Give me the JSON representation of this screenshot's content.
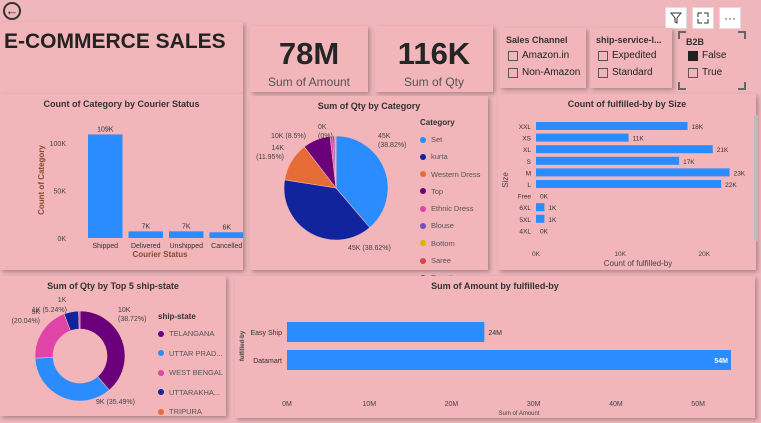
{
  "header": {
    "title": "E-COMMERCE SALES"
  },
  "kpis": {
    "amount": {
      "value": "78M",
      "label": "Sum of Amount"
    },
    "qty": {
      "value": "116K",
      "label": "Sum of Qty"
    }
  },
  "slicers": {
    "sales_channel": {
      "title": "Sales Channel",
      "options": [
        "Amazon.in",
        "Non-Amazon"
      ]
    },
    "ship_service": {
      "title": "ship-service-l...",
      "options": [
        "Expedited",
        "Standard"
      ]
    },
    "b2b": {
      "title": "B2B",
      "options": [
        "False",
        "True"
      ],
      "selected": "False"
    }
  },
  "toolbar": {
    "icons": [
      "filter-icon",
      "focus-mode-icon",
      "more-options-icon"
    ],
    "more_label": "···"
  },
  "colors": {
    "bar": "#2b8cff",
    "background": "#efb7bb"
  },
  "chart_data": [
    {
      "type": "bar",
      "title": "Count of Category by Courier Status",
      "categories": [
        "Shipped",
        "Delivered",
        "Unshipped",
        "Cancelled"
      ],
      "values": [
        109000,
        7000,
        7000,
        6000
      ],
      "data_labels": [
        "109K",
        "7K",
        "7K",
        "6K"
      ],
      "xlabel": "Courier Status",
      "ylabel": "Count of Category",
      "yticks": [
        "0K",
        "50K",
        "100K"
      ],
      "ylim": [
        0,
        120000
      ]
    },
    {
      "type": "pie",
      "title": "Sum of Qty by Category",
      "legend_title": "Category",
      "labels": [
        "Set",
        "kurta",
        "Western Dress",
        "Top",
        "Ethnic Dress",
        "Blouse",
        "Bottom",
        "Saree",
        "Dupatta"
      ],
      "values": [
        45000,
        45000,
        14000,
        10000,
        900,
        700,
        400,
        100,
        10
      ],
      "data_labels": [
        "45K (38.82%)",
        "45K (38.62%)",
        "14K (11.95%)",
        "10K (8.5%)",
        "0K (0%)"
      ],
      "colors": [
        "#2b8cff",
        "#12239e",
        "#e66c37",
        "#6b007b",
        "#e044a7",
        "#744ec2",
        "#d9b300",
        "#d64550",
        "#197278"
      ]
    },
    {
      "type": "bar",
      "orientation": "horizontal",
      "title": "Count of fulfilled-by by Size",
      "categories": [
        "XXL",
        "XS",
        "XL",
        "S",
        "M",
        "L",
        "Free",
        "6XL",
        "5XL",
        "4XL"
      ],
      "values": [
        18,
        11,
        21,
        17,
        23,
        22,
        0,
        1,
        1,
        0
      ],
      "data_labels": [
        "18K",
        "11K",
        "21K",
        "17K",
        "23K",
        "22K",
        "0K",
        "1K",
        "1K",
        "0K"
      ],
      "xlabel": "Count of fulfilled-by",
      "ylabel": "Size",
      "xticks": [
        "0K",
        "10K",
        "20K"
      ],
      "xlim": [
        0,
        24
      ]
    },
    {
      "type": "pie",
      "donut": true,
      "title": "Sum of Qty by Top 5 ship-state",
      "legend_title": "ship-state",
      "labels": [
        "TELANGANA",
        "UTTAR PRAD...",
        "WEST BENGAL",
        "UTTARAKHA...",
        "TRIPURA"
      ],
      "values": [
        38.72,
        35.49,
        20.04,
        5.24,
        0.51
      ],
      "data_labels": [
        "10K (38.72%)",
        "9K (35.49%)",
        "5K (20.04%)",
        "1K (5.24%)",
        "1K"
      ],
      "colors": [
        "#6b007b",
        "#2b8cff",
        "#e044a7",
        "#12239e",
        "#e66c37"
      ]
    },
    {
      "type": "bar",
      "orientation": "horizontal",
      "title": "Sum of Amount by fulfilled-by",
      "categories": [
        "Easy Ship",
        "Datamart"
      ],
      "values": [
        24,
        54
      ],
      "data_labels": [
        "24M",
        "54M"
      ],
      "xlabel": "Sum of Amount",
      "ylabel": "fulfilled-by",
      "xticks": [
        "0M",
        "10M",
        "20M",
        "30M",
        "40M",
        "50M"
      ],
      "xlim": [
        0,
        54
      ]
    }
  ]
}
